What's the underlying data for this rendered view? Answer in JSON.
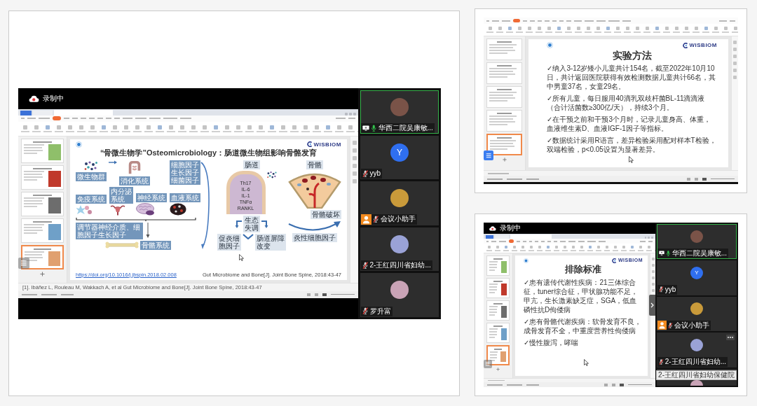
{
  "main_share": {
    "recording_label": "录制中",
    "thumbnails": [
      {
        "selected": false
      },
      {
        "selected": false
      },
      {
        "selected": false
      },
      {
        "selected": false
      },
      {
        "selected": true
      }
    ],
    "slide": {
      "title": "“骨微生物学”Osteomicrobiology：肠道微生物组影响骨骼发育",
      "logo": "WISBIOM",
      "left_figure": {
        "microbiota": "微生物群",
        "digestive_system": "消化系统",
        "factors": "细胞因子生长因子细菌因子",
        "systems": [
          {
            "kind": "immune",
            "label": "免疫系统"
          },
          {
            "kind": "endocrine",
            "label": "内分泌系统"
          },
          {
            "kind": "nervous",
            "label": "神经系统"
          },
          {
            "kind": "blood",
            "label": "血液系统"
          }
        ],
        "regulators": "调节器神经介质、细胞因子生长因子",
        "skeletal_system": "骨骼系统"
      },
      "right_figure": {
        "gut": "肠道",
        "gut_markers": [
          "Th17",
          "IL-6",
          "IL-1",
          "TNFα",
          "RANKL"
        ],
        "bone": "骨骼",
        "bone_damage": "骨骼破坏",
        "dysbiosis": "生态失调",
        "proinflammatory_factors": "促炎细胞因子",
        "barrier_change": "肠道屏障改变",
        "inflammatory_factors": "炎性细胞因子"
      },
      "link": "https://doi.org/10.1016/j.jbspin.2018.02.008",
      "citation": "Gut Microbiome and Bone[J]. Joint Bone Spine, 2018:43-47"
    },
    "notes": "[1]. Ibáñez L, Rouleau M, Wakkach A, et al Gut Microbiome and Bone[J]. Joint Bone Spine, 2018:43-47",
    "participants": [
      {
        "name": "华西二院吴康敏...",
        "kind": "photo",
        "active": true,
        "sharing": true,
        "muted": false,
        "assistant": false
      },
      {
        "name": "yyb",
        "kind": "letter",
        "initial": "Y",
        "active": false,
        "sharing": false,
        "muted": true,
        "assistant": false
      },
      {
        "name": "会议小助手",
        "kind": "photo",
        "active": false,
        "sharing": false,
        "muted": true,
        "assistant": true
      },
      {
        "name": "2-王红四川省妇幼...",
        "kind": "photo",
        "active": false,
        "sharing": false,
        "muted": true,
        "assistant": false
      },
      {
        "name": "罗升富",
        "kind": "photo",
        "active": false,
        "sharing": false,
        "muted": true,
        "assistant": false
      }
    ]
  },
  "top_right_share": {
    "thumbnails": [
      {
        "selected": false
      },
      {
        "selected": false
      },
      {
        "selected": false
      },
      {
        "selected": false
      },
      {
        "selected": true
      }
    ],
    "slide": {
      "logo": "WISBIOM",
      "title": "实验方法",
      "bullets": [
        "✓纳入3-12岁矮小儿童共计154名，截至2022年10月10日，共计返回医院获得有效检测数据儿童共计66名，其中男童37名，女童29名。",
        "✓所有儿童，每日服用40滴乳双歧杆菌BL-11滴滴液（合计活菌数≥300亿/天），持续3个月。",
        "✓在干预之前和干预3个月时，记录儿童身高、体重，血液维生素D、血液IGF-1因子等指标。",
        "✓数据统计采用R语言，差异检验采用配对样本T检验，双端检验，p<0.05设置为显著差异。"
      ]
    }
  },
  "bottom_right_share": {
    "recording_label": "录制中",
    "thumbnails": [
      {
        "selected": false
      },
      {
        "selected": false
      },
      {
        "selected": false
      },
      {
        "selected": false
      },
      {
        "selected": true
      }
    ],
    "slide": {
      "logo": "WISBIOM",
      "title": "排除标准",
      "bullets": [
        "✓患有遗传代谢性疾病：21三体综合征，tuner综合征，甲状腺功能不足，甲亢，生长激素缺乏症，SGA，低血磷性抗D佝偻病",
        "✓患有骨骼代谢疾病：软骨发育不良，成骨发育不全，中重度营养性佝偻病",
        "✓慢性腹泻，哮喘"
      ]
    },
    "participants": [
      {
        "name": "华西二院吴康敏...",
        "kind": "photo",
        "active": true,
        "sharing": true,
        "muted": false,
        "assistant": false,
        "hovered": false
      },
      {
        "name": "yyb",
        "kind": "letter",
        "initial": "Y",
        "active": false,
        "sharing": false,
        "muted": true,
        "assistant": false,
        "hovered": false
      },
      {
        "name": "会议小助手",
        "kind": "photo",
        "active": false,
        "sharing": false,
        "muted": true,
        "assistant": true,
        "hovered": false
      },
      {
        "name": "2-王红四川省妇幼...",
        "kind": "photo",
        "active": false,
        "sharing": false,
        "muted": true,
        "assistant": false,
        "hovered": true
      }
    ],
    "tooltip": "2-王红四川省妇幼保健院"
  }
}
